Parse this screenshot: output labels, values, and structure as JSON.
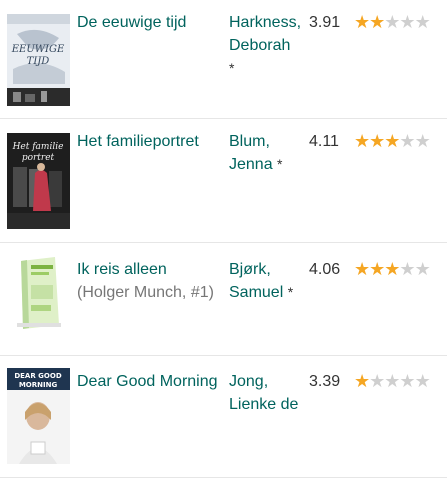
{
  "books": [
    {
      "title": "De eeuwige tijd",
      "series": "",
      "author": "Harkness, Deborah",
      "author_mark": "*",
      "avg_rating": "3.91",
      "stars_filled": 2,
      "stars_total": 5,
      "cover_icon": "book-cover-1",
      "cover_text": "De EEUWIGE TIJD"
    },
    {
      "title": "Het familieportret",
      "series": "",
      "author": "Blum, Jenna",
      "author_mark": "*",
      "avg_rating": "4.11",
      "stars_filled": 3,
      "stars_total": 5,
      "cover_icon": "book-cover-2",
      "cover_text": "Het familie portret"
    },
    {
      "title": "Ik reis alleen",
      "series": "(Holger Munch, #1)",
      "author": "Bjørk, Samuel",
      "author_mark": "*",
      "avg_rating": "4.06",
      "stars_filled": 3,
      "stars_total": 5,
      "cover_icon": "book-cover-3",
      "cover_text": ""
    },
    {
      "title": "Dear Good Morning",
      "series": "",
      "author": "Jong, Lienke de",
      "author_mark": "",
      "avg_rating": "3.39",
      "stars_filled": 1,
      "stars_total": 5,
      "cover_icon": "book-cover-4",
      "cover_text": "DEAR GOOD MORNING"
    }
  ],
  "colors": {
    "link": "#00635d",
    "star_on": "#f5a623",
    "star_off": "#cfcfcf",
    "divider": "#e6e6e6"
  }
}
